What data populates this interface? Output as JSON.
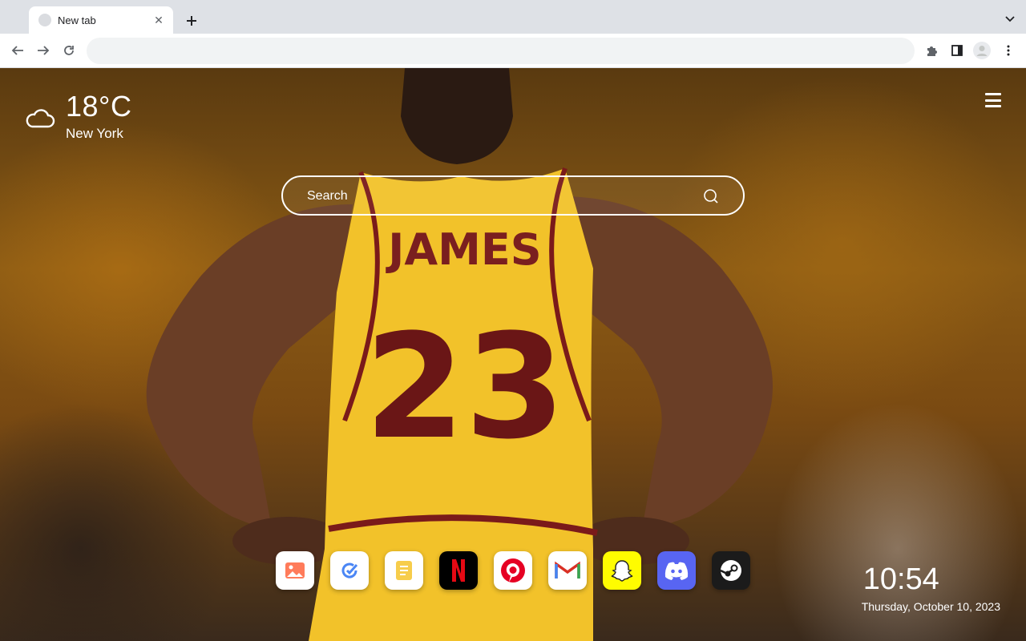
{
  "browser": {
    "tab": {
      "title": "New tab",
      "close_glyph": "✕"
    },
    "new_tab_glyph": "+",
    "omnibox": {
      "value": "",
      "placeholder": ""
    }
  },
  "weather": {
    "temperature": "18°C",
    "city": "New York",
    "icon": "cloud-icon"
  },
  "search": {
    "placeholder": "Search"
  },
  "shortcuts": [
    {
      "name": "Photos",
      "icon": "photo-icon",
      "color": "#ffffff"
    },
    {
      "name": "Tasks",
      "icon": "refresh-check-icon",
      "color": "#ffffff"
    },
    {
      "name": "Notes",
      "icon": "notes-icon",
      "color": "#ffffff"
    },
    {
      "name": "Netflix",
      "icon": "netflix-icon",
      "color": "#000000"
    },
    {
      "name": "Pinterest",
      "icon": "pinterest-icon",
      "color": "#ffffff"
    },
    {
      "name": "Gmail",
      "icon": "gmail-icon",
      "color": "#ffffff"
    },
    {
      "name": "Snapchat",
      "icon": "snapchat-icon",
      "color": "#fffc00"
    },
    {
      "name": "Discord",
      "icon": "discord-icon",
      "color": "#5865f2"
    },
    {
      "name": "Steam",
      "icon": "steam-icon",
      "color": "#1b1b1b"
    }
  ],
  "clock": {
    "time": "10:54",
    "date": "Thursday, October 10, 2023"
  },
  "jersey": {
    "name": "JAMES",
    "number": "23"
  }
}
